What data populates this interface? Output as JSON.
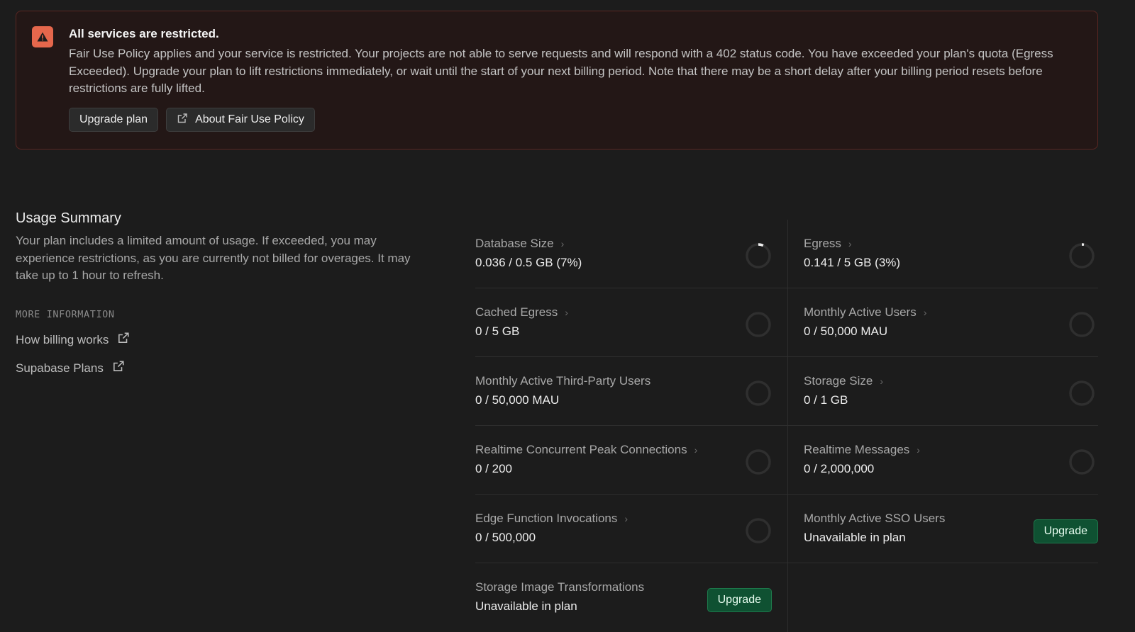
{
  "alert": {
    "icon": "warning-triangle-icon",
    "accent_color": "#e5674c",
    "title": "All services are restricted.",
    "body": "Fair Use Policy applies and your service is restricted. Your projects are not able to serve requests and will respond with a 402 status code. You have exceeded your plan's quota (Egress Exceeded). Upgrade your plan to lift restrictions immediately, or wait until the start of your next billing period. Note that there may be a short delay after your billing period resets before restrictions are fully lifted.",
    "upgrade_label": "Upgrade plan",
    "fair_use_label": "About Fair Use Policy"
  },
  "summary": {
    "title": "Usage Summary",
    "description": "Your plan includes a limited amount of usage. If exceeded, you may experience restrictions, as you are currently not billed for overages. It may take up to 1 hour to refresh.",
    "more_info_label": "MORE INFORMATION",
    "links": [
      {
        "label": "How billing works",
        "icon": "external-link-icon"
      },
      {
        "label": "Supabase Plans",
        "icon": "external-link-icon"
      }
    ]
  },
  "usage": {
    "upgrade_color": "#0f5132",
    "items": [
      {
        "label": "Database Size",
        "value": "0.036 / 0.5 GB (7%)",
        "percent": 7
      },
      {
        "label": "Egress",
        "value": "0.141 / 5 GB (3%)",
        "percent": 3
      },
      {
        "label": "Cached Egress",
        "value": "0 / 5 GB",
        "percent": 0
      },
      {
        "label": "Monthly Active Users",
        "value": "0 / 50,000 MAU",
        "percent": 0
      },
      {
        "label": "Monthly Active Third-Party Users",
        "value": "0 / 50,000 MAU",
        "percent": 0
      },
      {
        "label": "Storage Size",
        "value": "0 / 1 GB",
        "percent": 0
      },
      {
        "label": "Realtime Concurrent Peak Connections",
        "value": "0 / 200",
        "percent": 0
      },
      {
        "label": "Realtime Messages",
        "value": "0 / 2,000,000",
        "percent": 0
      },
      {
        "label": "Edge Function Invocations",
        "value": "0 / 500,000",
        "percent": 0
      },
      {
        "label": "Monthly Active SSO Users",
        "value": "Unavailable in plan",
        "upgrade_label": "Upgrade"
      },
      {
        "label": "Storage Image Transformations",
        "value": "Unavailable in plan",
        "upgrade_label": "Upgrade"
      }
    ]
  }
}
